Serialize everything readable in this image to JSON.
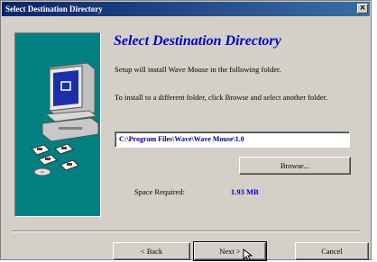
{
  "window": {
    "title": "Select Destination Directory",
    "close_glyph": "×"
  },
  "main": {
    "heading": "Select Destination Directory",
    "line1": "Setup will install Wave Mouse in the following folder.",
    "line2": "To install to a different folder, click Browse and select another folder.",
    "path_value": "C:\\Program Files\\Wave\\Wave Mouse\\1.0",
    "space_label": "Space Required:",
    "space_value": "1.93 MB"
  },
  "buttons": {
    "browse": "Browse...",
    "back": "< Back",
    "next": "Next >",
    "cancel": "Cancel"
  },
  "colors": {
    "panel": "#008080",
    "heading": "#0000cc",
    "titlebar": "#0a246a"
  },
  "icons": {
    "illustration": "computer-with-disks-icon"
  }
}
